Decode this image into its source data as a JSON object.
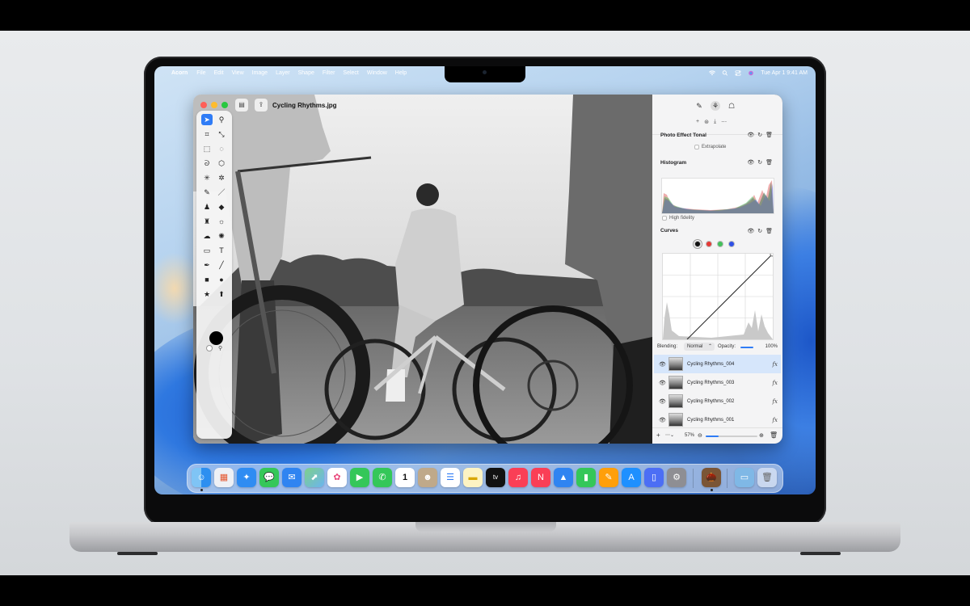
{
  "menubar": {
    "app_name": "Acorn",
    "items": [
      "File",
      "Edit",
      "View",
      "Image",
      "Layer",
      "Shape",
      "Filter",
      "Select",
      "Window",
      "Help"
    ],
    "datetime": "Tue Apr 1  9:41 AM"
  },
  "window": {
    "title": "Cycling Rhythms.jpg"
  },
  "inspector": {
    "photo_effect": {
      "title": "Photo Effect Tonal",
      "option": "Extrapolate"
    },
    "histogram": {
      "title": "Histogram",
      "option": "High fidelity"
    },
    "curves": {
      "title": "Curves",
      "channel_colors": [
        "#111111",
        "#e53935",
        "#43c05a",
        "#2f50e6"
      ]
    },
    "blending": {
      "label": "Blending:",
      "value": "Normal",
      "opacity_label": "Opacity:",
      "opacity_value": "100%"
    },
    "layers": [
      {
        "name": "Cycling Rhythms_004",
        "selected": true,
        "fx": "fx"
      },
      {
        "name": "Cycling Rhythms_003",
        "selected": false,
        "fx": "fx"
      },
      {
        "name": "Cycling Rhythms_002",
        "selected": false,
        "fx": "fx"
      },
      {
        "name": "Cycling Rhythms_001",
        "selected": false,
        "fx": "fx"
      }
    ],
    "zoom": "57%"
  },
  "dock": {
    "calendar_day": "1",
    "tv_label": "tv",
    "icons": [
      "finder-icon",
      "launchpad-icon",
      "safari-icon",
      "messages-icon",
      "mail-icon",
      "maps-icon",
      "photos-icon",
      "facetime-icon",
      "phone-icon",
      "calendar-icon",
      "contacts-icon",
      "reminders-icon",
      "notes-icon",
      "tv-icon",
      "music-icon",
      "news-icon",
      "keynote-icon",
      "numbers-icon",
      "pages-icon",
      "app-store-icon",
      "iphone-mirroring-icon",
      "system-settings-icon",
      "acorn-icon",
      "downloads-folder-icon",
      "trash-icon"
    ]
  }
}
